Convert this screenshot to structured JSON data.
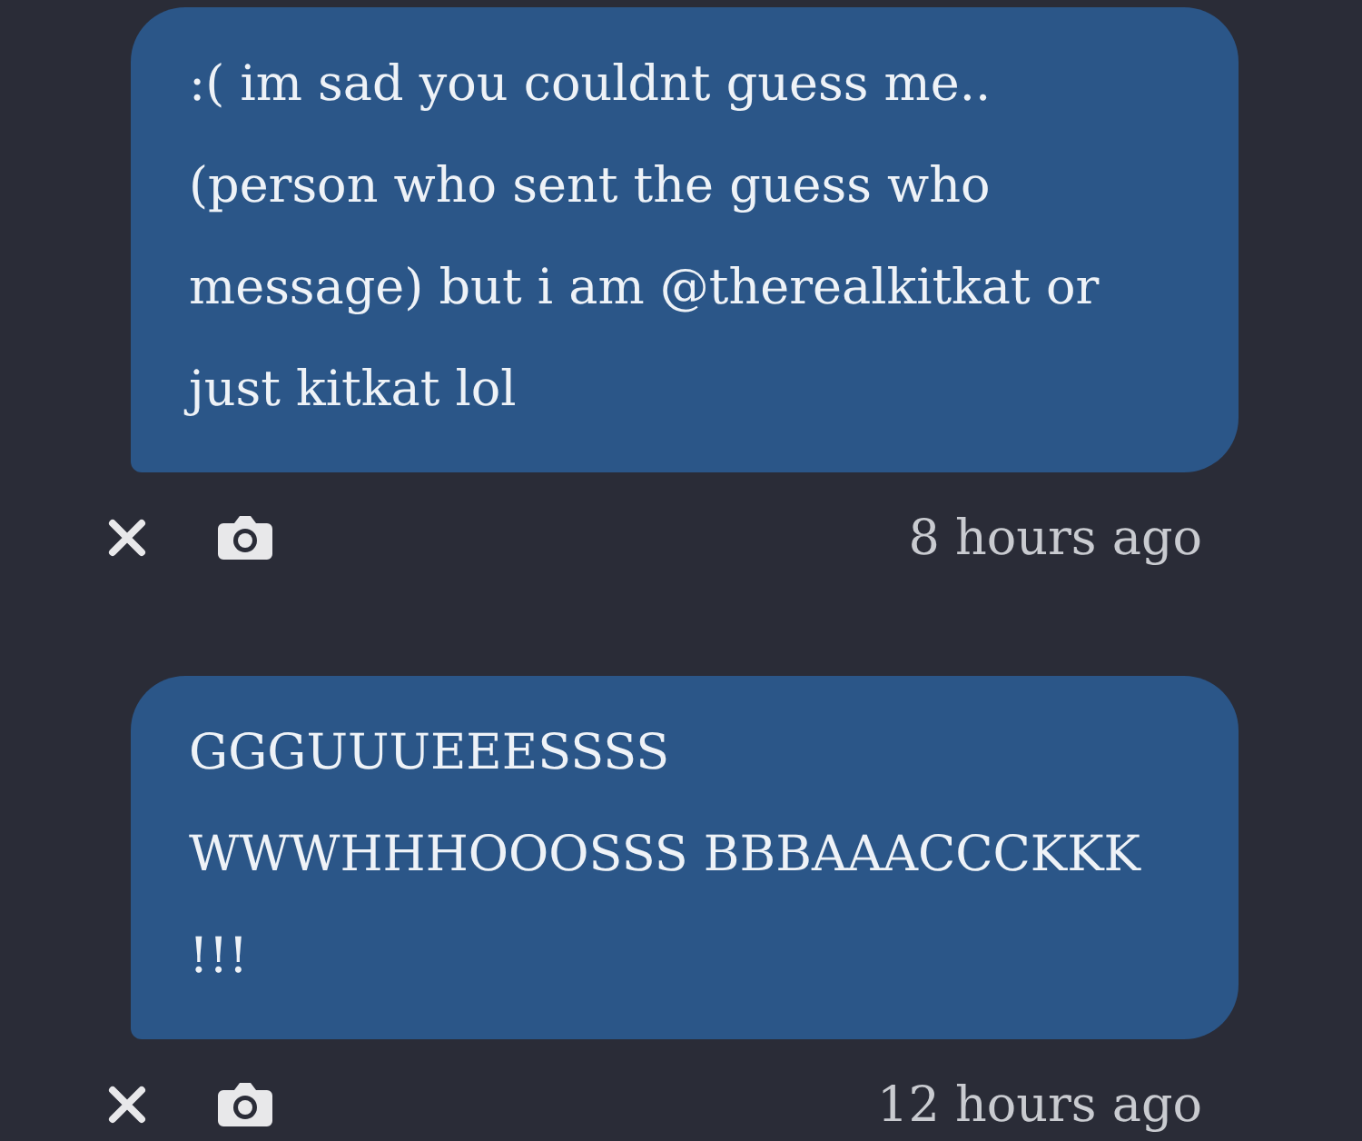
{
  "messages": [
    {
      "text": ":( im sad you couldnt guess me.. (person who sent the guess who message) but i am @therealkitkat or just kitkat lol",
      "time": "8 hours ago"
    },
    {
      "text": "GGGUUUEEESSSS WWWHHHOOOSSS BBBAAACCCKKK !!!",
      "time": "12 hours ago"
    }
  ]
}
